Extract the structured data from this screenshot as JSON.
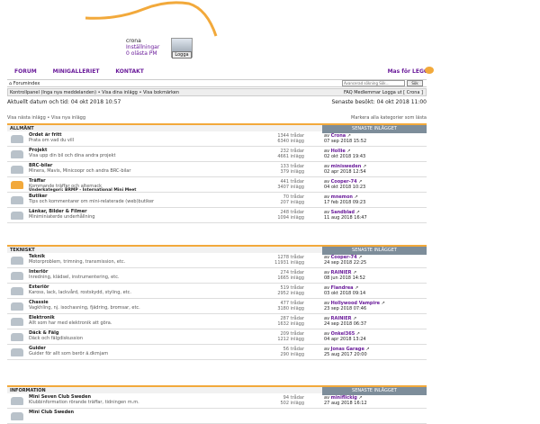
{
  "colors": {
    "accent": "#f2a93b",
    "link": "#6a1b9a",
    "latest_bg": "#7d8d9a"
  },
  "user": {
    "name": "crona",
    "settings": "Inställningar",
    "pm": "0 olästa PM",
    "logout": "Logga"
  },
  "nav": {
    "forum": "FORUM",
    "gallery": "MINIGALLERIET",
    "contact": "KONTAKT",
    "brand": "Mas för LEGO"
  },
  "search": {
    "label": "Forumindex",
    "placeholder": "Avancerad sökning Sök…",
    "button": "Sök"
  },
  "breadcrumb": "Kontrollpanel (Inga nya meddelanden) • Visa dina inlägg • Visa bokmärken",
  "quicklinks": "FAQ  Medlemmar  Logga ut [ Crona ]",
  "dates": {
    "current": "Aktuellt datum och tid: 04 okt 2018 10:57",
    "last_visit": "Senaste besökt: 04 okt 2018 11:00"
  },
  "links": {
    "left": "Visa nästa inlägg • Visa nya inlägg",
    "right": "Markera alla kategorier som lästa"
  },
  "latest_label": "SENASTE INLÄGGET",
  "sections": [
    {
      "name": "ALLMÄNT",
      "forums": [
        {
          "title": "Ordet är fritt",
          "desc": "Prata om vad du vill",
          "sub": "",
          "topics": "1344 trådar",
          "posts": "6340 inlägg",
          "by": "Crona",
          "date": "07 sep 2018 15:52",
          "hot": false
        },
        {
          "title": "Projekt",
          "desc": "Visa upp din bil och dina andra projekt",
          "sub": "",
          "topics": "232 trådar",
          "posts": "4661 inlägg",
          "by": "Hollie",
          "date": "02 okt 2018 19:43",
          "hot": false
        },
        {
          "title": "BRC-bilar",
          "desc": "Minera, Mavis, Minicoopr och andra BRC-bilar",
          "sub": "",
          "topics": "133 trådar",
          "posts": "379 inlägg",
          "by": "minisweden",
          "date": "02 apr 2018 12:54",
          "hot": false
        },
        {
          "title": "Träffar",
          "desc": "Kommande träffar och alternack",
          "sub": "Underkategori: BRMP - International Mini Meet",
          "topics": "441 trådar",
          "posts": "3407 inlägg",
          "by": "Cooper-74",
          "date": "04 okt 2018 10:23",
          "hot": true
        },
        {
          "title": "Butiker",
          "desc": "Tips och kommentarer om mini-relaterade (web)butiker",
          "sub": "",
          "topics": "70 trådar",
          "posts": "207 inlägg",
          "by": "mnemon",
          "date": "17 feb 2018 09:23",
          "hot": false
        },
        {
          "title": "Länkar, Bilder & Filmer",
          "desc": "Miniminiaterde underhållning",
          "sub": "",
          "topics": "248 trådar",
          "posts": "1094 inlägg",
          "by": "Sandblad",
          "date": "11 aug 2018 16:47",
          "hot": false
        }
      ]
    },
    {
      "name": "TEKNISKT",
      "forums": [
        {
          "title": "Teknik",
          "desc": "Motorproblem, trimning, transmission, etc.",
          "sub": "",
          "topics": "1278 trådar",
          "posts": "11931 inlägg",
          "by": "Cooper-74",
          "date": "24 sep 2018 22:25",
          "hot": false
        },
        {
          "title": "Interiör",
          "desc": "Inredning, klädsel, instrumentering, etc.",
          "sub": "",
          "topics": "274 trådar",
          "posts": "1665 inlägg",
          "by": "RAINIER",
          "date": "08 jun 2018 14:52",
          "hot": false
        },
        {
          "title": "Exteriör",
          "desc": "Kaross, lack, lackvård, rostskydd, styling, etc.",
          "sub": "",
          "topics": "519 trådar",
          "posts": "2952 inlägg",
          "by": "Flandrea",
          "date": "03 okt 2018 09:14",
          "hot": false
        },
        {
          "title": "Chassie",
          "desc": "Vagkhling, nj. isochasning, fjädring, bromsar, etc.",
          "sub": "",
          "topics": "477 trådar",
          "posts": "3180 inlägg",
          "by": "Hollywood Vampire",
          "date": "23 sep 2018 07:46",
          "hot": false
        },
        {
          "title": "Elektronik",
          "desc": "Allt som har med elektronik att göra.",
          "sub": "",
          "topics": "287 trådar",
          "posts": "1632 inlägg",
          "by": "RAINIER",
          "date": "24 sep 2018 06:37",
          "hot": false
        },
        {
          "title": "Däck & Fälg",
          "desc": "Däck och fälgdiskussion",
          "sub": "",
          "topics": "209 trådar",
          "posts": "1212 inlägg",
          "by": "Onkel365",
          "date": "04 apr 2018 13:24",
          "hot": false
        },
        {
          "title": "Guider",
          "desc": "Guider för allt som berör ä.dkmjam",
          "sub": "",
          "topics": "56 trådar",
          "posts": "290 inlägg",
          "by": "Jonas Garage",
          "date": "25 aug 2017 20:00",
          "hot": false
        }
      ]
    },
    {
      "name": "INFORMATION",
      "forums": [
        {
          "title": "Mini Seven Club Sweden",
          "desc": "Klubbinformation rörande träffar, tidningen m.m.",
          "sub": "",
          "topics": "94 trådar",
          "posts": "502 inlägg",
          "by": "miniflickig",
          "date": "27 aug 2018 16:12",
          "hot": false
        },
        {
          "title": "Mini Club Sweden",
          "desc": "",
          "sub": "",
          "topics": "",
          "posts": "",
          "by": "",
          "date": "",
          "hot": false
        }
      ]
    }
  ]
}
